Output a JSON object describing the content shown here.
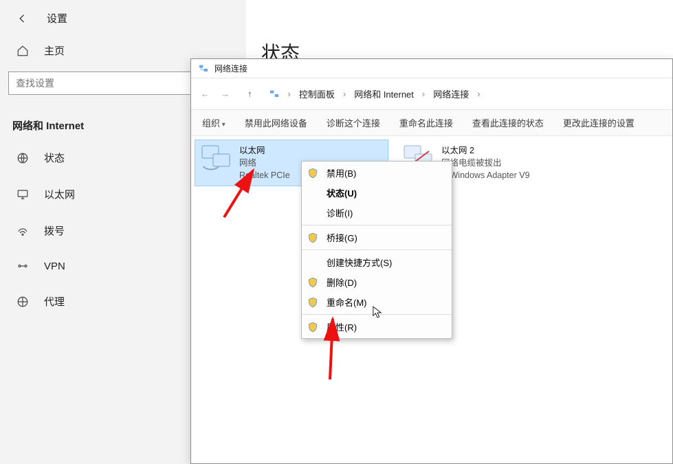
{
  "settings": {
    "title": "设置",
    "home": "主页",
    "search_placeholder": "查找设置",
    "section": "网络和 Internet",
    "items": [
      {
        "label": "状态",
        "icon": "globe-icon"
      },
      {
        "label": "以太网",
        "icon": "monitor-icon"
      },
      {
        "label": "拨号",
        "icon": "dialup-icon"
      },
      {
        "label": "VPN",
        "icon": "vpn-icon"
      },
      {
        "label": "代理",
        "icon": "proxy-icon"
      }
    ]
  },
  "content": {
    "heading": "状态"
  },
  "nc": {
    "title": "网络连接",
    "breadcrumb": {
      "a": "控制面板",
      "b": "网络和 Internet",
      "c": "网络连接"
    },
    "toolbar": {
      "organize": "组织",
      "disable": "禁用此网络设备",
      "diagnose": "诊断这个连接",
      "rename": "重命名此连接",
      "view_status": "查看此连接的状态",
      "change": "更改此连接的设置"
    },
    "adapters": [
      {
        "name": "以太网",
        "line2": "网络",
        "line3": "Realtek PCIe",
        "selected": true
      },
      {
        "name": "以太网 2",
        "line2": "网络电缆被拔出",
        "line3": "P-Windows Adapter V9",
        "selected": false
      }
    ],
    "context_menu": [
      {
        "label": "禁用(B)",
        "shield": true
      },
      {
        "label": "状态(U)",
        "bold": true
      },
      {
        "label": "诊断(I)"
      },
      {
        "sep": true
      },
      {
        "label": "桥接(G)",
        "shield": true
      },
      {
        "sep": true
      },
      {
        "label": "创建快捷方式(S)"
      },
      {
        "label": "删除(D)",
        "shield": true
      },
      {
        "label": "重命名(M)",
        "shield": true
      },
      {
        "sep": true
      },
      {
        "label": "属性(R)",
        "shield": true
      }
    ]
  }
}
